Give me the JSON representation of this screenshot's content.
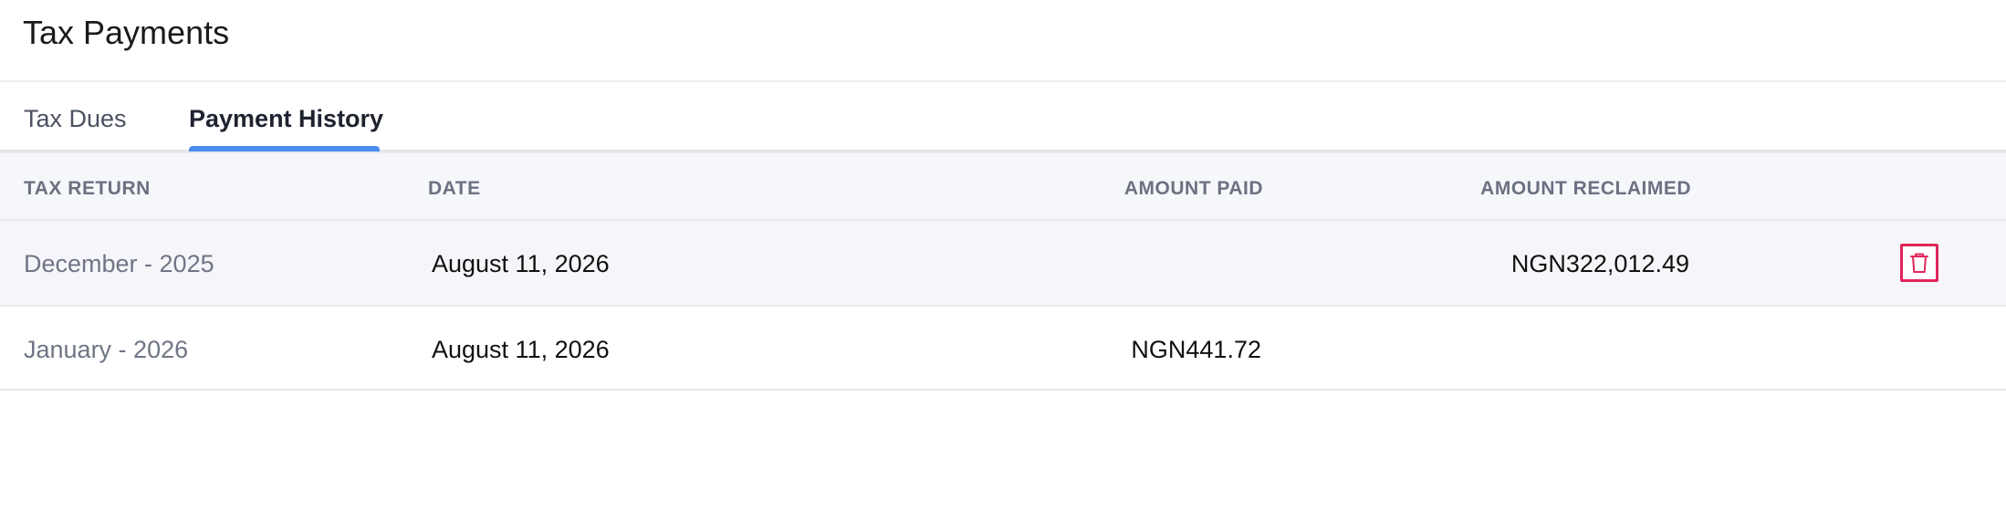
{
  "page": {
    "title": "Tax Payments"
  },
  "tabs": [
    {
      "label": "Tax Dues",
      "active": false
    },
    {
      "label": "Payment History",
      "active": true
    }
  ],
  "table": {
    "columns": [
      "TAX RETURN",
      "DATE",
      "AMOUNT PAID",
      "AMOUNT RECLAIMED"
    ],
    "rows": [
      {
        "tax_return": "December - 2025",
        "date": "August 11, 2026",
        "amount_paid": "",
        "amount_reclaimed": "NGN322,012.49",
        "action_icon": "trash-icon"
      },
      {
        "tax_return": "January - 2026",
        "date": "August 11, 2026",
        "amount_paid": "NGN441.72",
        "amount_reclaimed": ""
      }
    ]
  },
  "colors": {
    "accent": "#4a8df0",
    "danger": "#e0265a"
  }
}
